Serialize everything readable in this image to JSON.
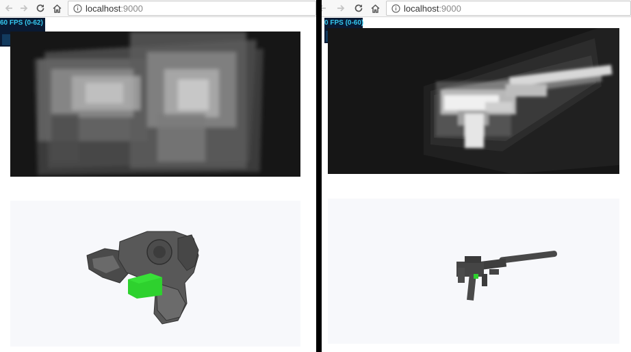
{
  "left_window": {
    "address_bar": {
      "host": "localhost",
      "port": ":9000"
    },
    "fps_meter": {
      "label": "60 FPS (0-62)",
      "fill_fraction": 0.97
    },
    "top_viewport": {
      "background": "#161616"
    },
    "bottom_viewport": {
      "background": "#f7f8fb",
      "highlight_color": "#2ed12e"
    }
  },
  "right_window": {
    "address_bar": {
      "host": "localhost",
      "port": ":9000"
    },
    "fps_meter": {
      "label": "0 FPS (0-60)",
      "fill_fraction": 1.0
    },
    "top_viewport": {
      "background": "#161616"
    },
    "bottom_viewport": {
      "background": "#f7f8fb",
      "highlight_color": "#2ed12e"
    }
  },
  "icons": {
    "back": "back-arrow-icon",
    "forward": "forward-arrow-icon",
    "reload": "reload-icon",
    "home": "home-icon",
    "info": "info-icon"
  }
}
